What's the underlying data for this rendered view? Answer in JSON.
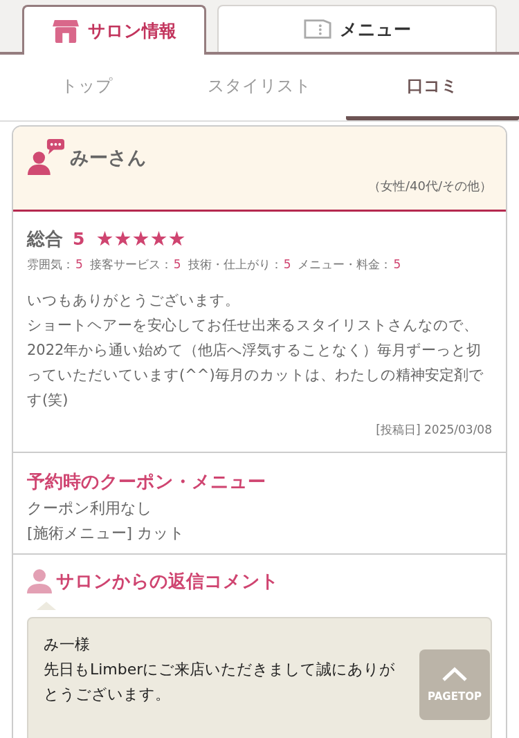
{
  "main_tabs": [
    {
      "label": "サロン情報",
      "selected": true
    },
    {
      "label": "メニュー",
      "selected": false
    }
  ],
  "sub_tabs": [
    {
      "label": "トップ",
      "selected": false
    },
    {
      "label": "スタイリスト",
      "selected": false
    },
    {
      "label": "口コミ",
      "selected": true
    }
  ],
  "review": {
    "reviewer": "みーさん",
    "profile": "（女性/40代/その他）",
    "overall": {
      "label": "総合",
      "score": "5",
      "stars": 5
    },
    "ratings": [
      {
        "label": "雰囲気：",
        "score": "5"
      },
      {
        "label": "接客サービス：",
        "score": "5"
      },
      {
        "label": "技術・仕上がり：",
        "score": "5"
      },
      {
        "label": "メニュー・料金：",
        "score": "5"
      }
    ],
    "body": [
      "いつもありがとうございます。",
      "ショートヘアーを安心してお任せ出来るスタイリストさんなので、2022年から通い始めて（他店へ浮気することなく）毎月ずーっと切っていただいています(^^)毎月のカットは、わたしの精神安定剤です(笑)"
    ],
    "posted": "[投稿日] 2025/03/08"
  },
  "coupon": {
    "title": "予約時のクーポン・メニュー",
    "lines": [
      "クーポン利用なし",
      "[施術メニュー] カット"
    ]
  },
  "reply": {
    "title": "サロンからの返信コメント",
    "lines": [
      "み一様",
      "先日もLimberにご来店いただきまして誠にありがとうございます。"
    ]
  },
  "pagetop": {
    "label": "PAGETOP"
  }
}
